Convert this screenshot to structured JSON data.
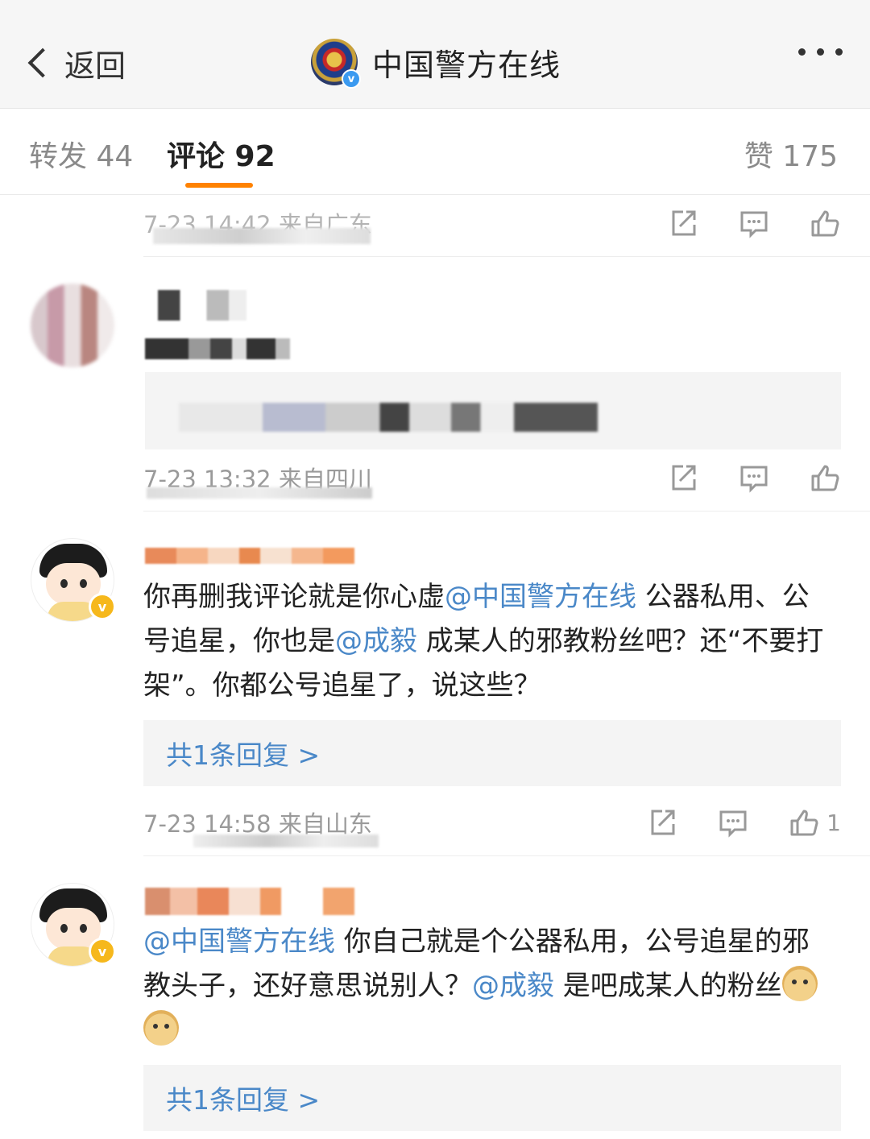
{
  "nav": {
    "back_label": "返回",
    "title": "中国警方在线",
    "verified_mark": "v"
  },
  "tabs": {
    "repost": "转发 44",
    "comment": "评论 92",
    "like": "赞 175"
  },
  "comments": [
    {
      "meta": "7-23 14:42 来自广东"
    },
    {
      "meta": "7-23 13:32 来自四川"
    },
    {
      "text_before_1": "你再删我评论就是你心虚",
      "mention_1": "@中国警方在线",
      "text_mid_1": " 公器私用、公号追星，你也是",
      "mention_2": "@成毅",
      "text_after": " 成某人的邪教粉丝吧？还“不要打架”。你都公号追星了，说这些？",
      "reply_label": "共1条回复 >",
      "meta": "7-23 14:58 来自山东",
      "like_count": "1"
    },
    {
      "mention_1": "@中国警方在线",
      "text_mid_1": " 你自己就是个公器私用，公号追星的邪教头子，还好意思说别人？",
      "mention_2": "@成毅",
      "text_after": " 是吧成某人的粉丝",
      "emoji": "doge-emoji",
      "reply_label": "共1条回复 >"
    }
  ],
  "colors": {
    "accent": "#ff8200",
    "link": "#4a88c8",
    "verified_gold": "#f6b81c",
    "verified_blue": "#3b9af0"
  }
}
